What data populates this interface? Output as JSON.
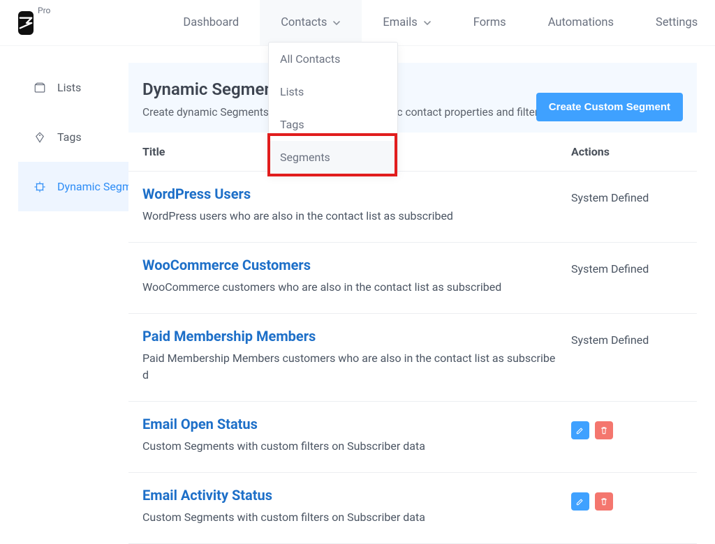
{
  "brand": {
    "pro_label": "Pro"
  },
  "nav": {
    "dashboard": "Dashboard",
    "contacts": "Contacts",
    "emails": "Emails",
    "forms": "Forms",
    "automations": "Automations",
    "settings": "Settings"
  },
  "dropdown": {
    "all_contacts": "All Contacts",
    "lists": "Lists",
    "tags": "Tags",
    "segments": "Segments"
  },
  "sidebar": {
    "lists": "Lists",
    "tags": "Tags",
    "dynamic_segments": "Dynamic Segments"
  },
  "header": {
    "title": "Dynamic Segments",
    "subtitle": "Create dynamic Segments based on different dynamic contact properties and filter your target audience",
    "create_btn": "Create Custom Segment"
  },
  "table": {
    "col_title": "Title",
    "col_actions": "Actions",
    "system_defined": "System Defined"
  },
  "segments": [
    {
      "title": "WordPress Users",
      "desc": "WordPress users who are also in the contact list as subscribed",
      "system": true
    },
    {
      "title": "WooCommerce Customers",
      "desc": "WooCommerce customers who are also in the contact list as subscribed",
      "system": true
    },
    {
      "title": "Paid Membership Members",
      "desc": "Paid Membership Members customers who are also in the contact list as subscribed",
      "system": true
    },
    {
      "title": "Email Open Status",
      "desc": "Custom Segments with custom filters on Subscriber data",
      "system": false
    },
    {
      "title": "Email Activity Status",
      "desc": "Custom Segments with custom filters on Subscriber data",
      "system": false
    }
  ]
}
